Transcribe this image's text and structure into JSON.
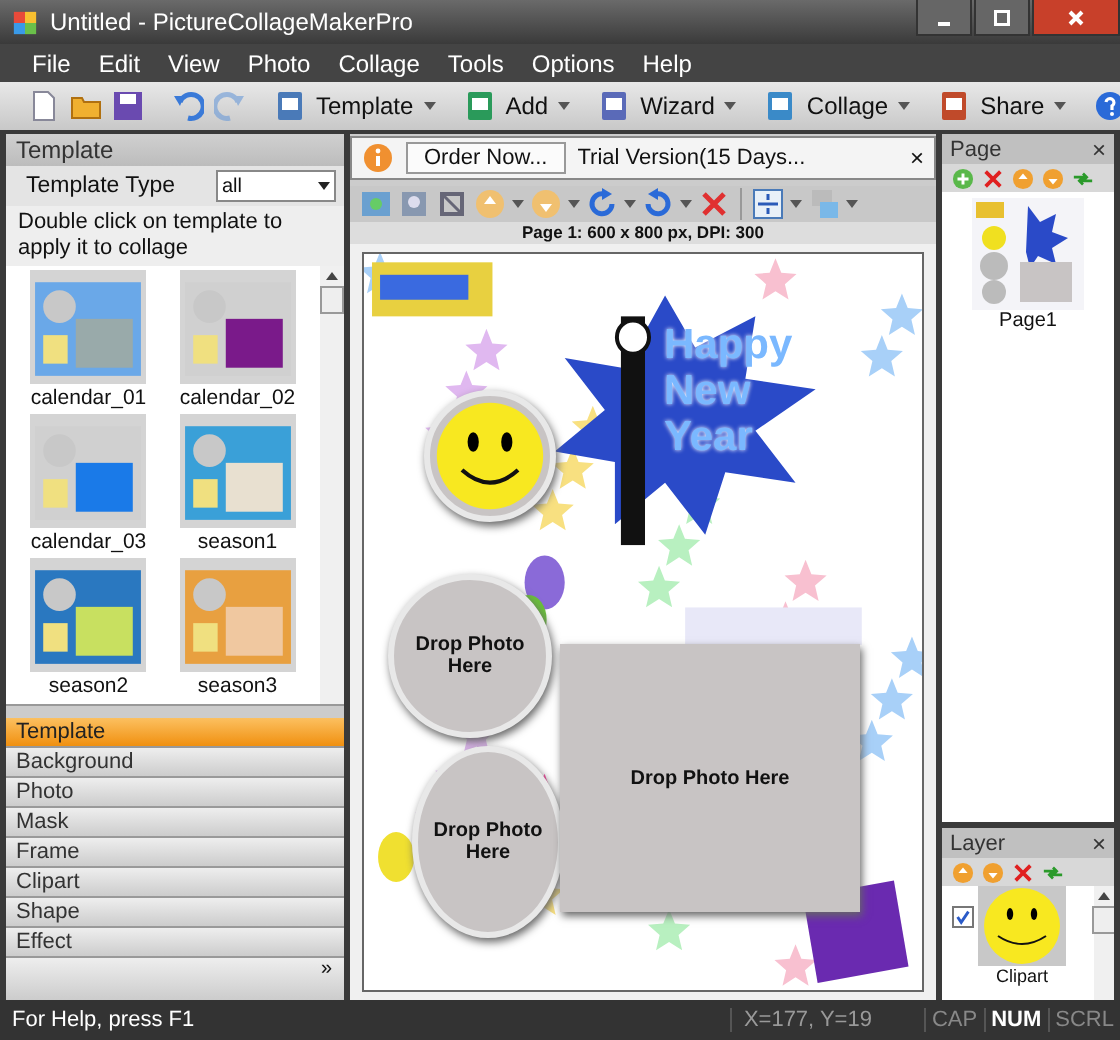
{
  "window": {
    "title": "Untitled - PictureCollageMakerPro"
  },
  "menu": [
    "File",
    "Edit",
    "View",
    "Photo",
    "Collage",
    "Tools",
    "Options",
    "Help"
  ],
  "toolbar_menus": [
    {
      "label": "Template"
    },
    {
      "label": "Add"
    },
    {
      "label": "Wizard"
    },
    {
      "label": "Collage"
    },
    {
      "label": "Share"
    }
  ],
  "template_panel": {
    "title": "Template",
    "type_label": "Template Type",
    "type_value": "all",
    "hint": "Double click on template to apply it to collage",
    "thumbnails": [
      {
        "label": "calendar_01"
      },
      {
        "label": "calendar_02"
      },
      {
        "label": "calendar_03"
      },
      {
        "label": "season1"
      },
      {
        "label": "season2"
      },
      {
        "label": "season3"
      }
    ]
  },
  "sections": [
    {
      "label": "Template",
      "selected": true
    },
    {
      "label": "Background",
      "selected": false
    },
    {
      "label": "Photo",
      "selected": false
    },
    {
      "label": "Mask",
      "selected": false
    },
    {
      "label": "Frame",
      "selected": false
    },
    {
      "label": "Clipart",
      "selected": false
    },
    {
      "label": "Shape",
      "selected": false
    },
    {
      "label": "Effect",
      "selected": false
    }
  ],
  "more_button": "»",
  "notice": {
    "button": "Order Now...",
    "text": "Trial Version(15 Days...",
    "close": "×"
  },
  "page_info": "Page 1: 600 x 800 px, DPI: 300",
  "canvas": {
    "clipart_text": "Happy New Year",
    "placeholders": [
      {
        "kind": "circle",
        "text": "Drop Photo Here"
      },
      {
        "kind": "circle",
        "text": "Drop Photo Here"
      },
      {
        "kind": "rect",
        "text": "Drop Photo Here"
      }
    ]
  },
  "page_panel": {
    "title": "Page",
    "close": "×",
    "pages": [
      {
        "label": "Page1"
      }
    ]
  },
  "layer_panel": {
    "title": "Layer",
    "close": "×",
    "layers": [
      {
        "label": "Clipart",
        "checked": true
      }
    ]
  },
  "status_bar": {
    "help": "For Help, press F1",
    "coords": "X=177, Y=19",
    "keys": [
      {
        "label": "CAP",
        "on": false
      },
      {
        "label": "NUM",
        "on": true
      },
      {
        "label": "SCRL",
        "on": false
      }
    ]
  }
}
